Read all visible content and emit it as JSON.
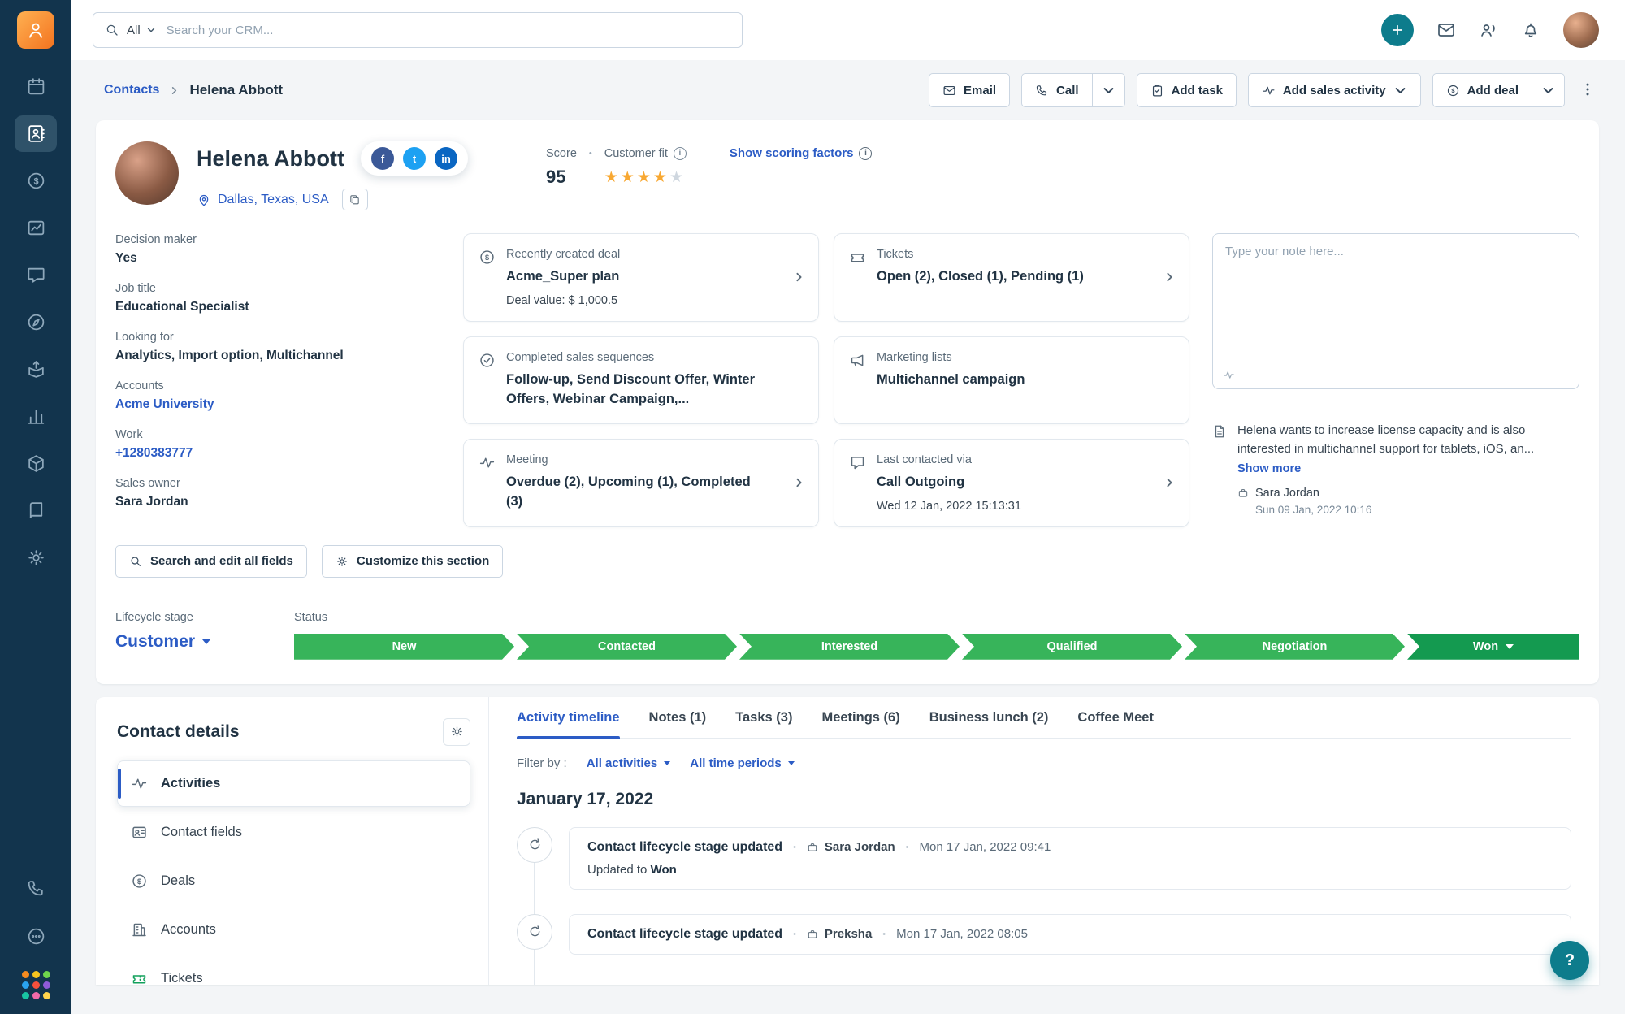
{
  "colors": {
    "sidebar": "#12344d",
    "accent_blue": "#2c5cc5",
    "teal": "#0d7c8c",
    "stage_green": "#37b45a",
    "won_green": "#149a50",
    "star_orange": "#f8a832"
  },
  "topbar": {
    "scope": "All",
    "placeholder": "Search your CRM..."
  },
  "breadcrumb": {
    "root": "Contacts",
    "current": "Helena Abbott"
  },
  "actions": {
    "email": "Email",
    "call": "Call",
    "add_task": "Add task",
    "add_sales_activity": "Add sales activity",
    "add_deal": "Add deal"
  },
  "contact": {
    "name": "Helena Abbott",
    "location": "Dallas, Texas, USA",
    "score_label": "Score",
    "score_value": "95",
    "customer_fit_label": "Customer fit",
    "scoring_link": "Show scoring factors",
    "rating": 4,
    "rating_max": 5
  },
  "fields": [
    {
      "label": "Decision maker",
      "value": "Yes"
    },
    {
      "label": "Job title",
      "value": "Educational Specialist"
    },
    {
      "label": "Looking for",
      "value": "Analytics, Import option, Multichannel"
    },
    {
      "label": "Accounts",
      "value": "Acme University"
    },
    {
      "label": "Work",
      "value": "+1280383777"
    },
    {
      "label": "Sales owner",
      "value": "Sara Jordan"
    }
  ],
  "cards": [
    {
      "icon": "deal-dollar-icon",
      "title": "Recently created deal",
      "main": "Acme_Super plan",
      "sub": "Deal value: $ 1,000.5"
    },
    {
      "icon": "ticket-icon",
      "title": "Tickets",
      "main": "Open (2), Closed (1), Pending (1)"
    },
    {
      "icon": "check-circle-icon",
      "title": "Completed sales sequences",
      "main": "Follow-up, Send Discount Offer, Winter Offers, Webinar Campaign,..."
    },
    {
      "icon": "megaphone-icon",
      "title": "Marketing lists",
      "main": "Multichannel campaign"
    },
    {
      "icon": "pulse-icon",
      "title": "Meeting",
      "main": "Overdue (2), Upcoming (1), Completed (3)"
    },
    {
      "icon": "chat-icon",
      "title": "Last contacted via",
      "main": "Call Outgoing",
      "sub": "Wed 12 Jan, 2022 15:13:31"
    }
  ],
  "notes": {
    "placeholder": "Type your note here...",
    "note_text": "Helena wants to increase license capacity and is also interested in multichannel support for tablets, iOS, an...",
    "show_more": "Show more",
    "author": "Sara Jordan",
    "timestamp": "Sun 09 Jan, 2022 10:16"
  },
  "section_buttons": {
    "search_edit": "Search and edit all fields",
    "customize": "Customize this section"
  },
  "lifecycle": {
    "label": "Lifecycle stage",
    "value": "Customer",
    "status_label": "Status",
    "stages": [
      "New",
      "Contacted",
      "Interested",
      "Qualified",
      "Negotiation"
    ],
    "final_stage": "Won"
  },
  "contact_details": {
    "title": "Contact details",
    "items": [
      {
        "label": "Activities"
      },
      {
        "label": "Contact fields"
      },
      {
        "label": "Deals"
      },
      {
        "label": "Accounts"
      },
      {
        "label": "Tickets"
      }
    ]
  },
  "activity": {
    "tabs": [
      "Activity timeline",
      "Notes (1)",
      "Tasks (3)",
      "Meetings (6)",
      "Business lunch (2)",
      "Coffee Meet"
    ],
    "filter_label": "Filter by :",
    "activity_filter": "All activities",
    "period_filter": "All time periods",
    "date_heading": "January 17, 2022",
    "events": [
      {
        "title": "Contact lifecycle stage updated",
        "author": "Sara Jordan",
        "time": "Mon 17 Jan, 2022 09:41",
        "detail_prefix": "Updated to",
        "detail_value": "Won"
      },
      {
        "title": "Contact lifecycle stage updated",
        "author": "Preksha",
        "time": "Mon 17 Jan, 2022 08:05"
      }
    ]
  },
  "help": {
    "label": "?"
  }
}
